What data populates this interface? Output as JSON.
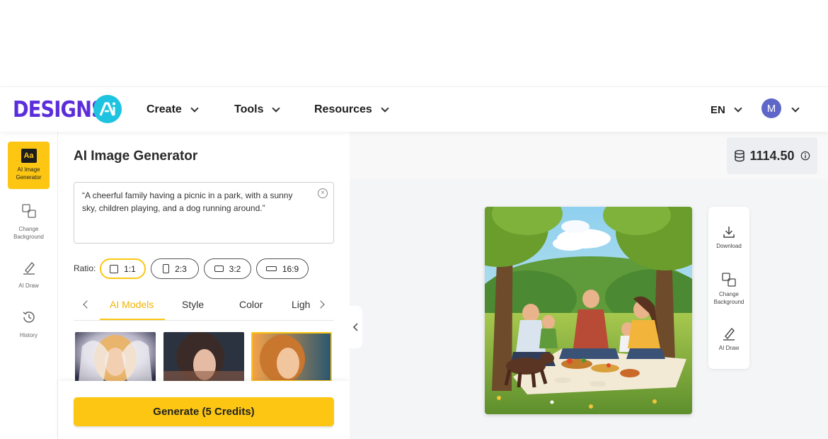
{
  "brand": {
    "logo_text": "DESIGNS.",
    "logo_mark": "AI"
  },
  "nav": {
    "items": [
      {
        "label": "Create"
      },
      {
        "label": "Tools"
      },
      {
        "label": "Resources"
      }
    ],
    "language": "EN",
    "avatar_initial": "M"
  },
  "rail": {
    "items": [
      {
        "label": "AI Image Generator",
        "icon": "aa-icon",
        "active": true
      },
      {
        "label": "Change Background",
        "icon": "change-background-icon"
      },
      {
        "label": "AI Draw",
        "icon": "pen-icon"
      },
      {
        "label": "History",
        "icon": "history-icon"
      }
    ]
  },
  "panel": {
    "title": "AI Image Generator",
    "prompt": "“A cheerful family having a picnic in a park, with a sunny sky, children playing, and a dog running around.”",
    "ratio_label": "Ratio:",
    "ratios": [
      {
        "label": "1:1",
        "active": true
      },
      {
        "label": "2:3"
      },
      {
        "label": "3:2"
      },
      {
        "label": "16:9"
      }
    ],
    "tabs": [
      {
        "label": "AI Models",
        "active": true
      },
      {
        "label": "Style"
      },
      {
        "label": "Color"
      },
      {
        "label": "Ligh"
      }
    ],
    "generate_label": "Generate (5 Credits)"
  },
  "main": {
    "credits": "1114.50",
    "tools": [
      {
        "label": "Download",
        "icon": "download-icon"
      },
      {
        "label": "Change Background",
        "icon": "change-background-icon"
      },
      {
        "label": "AI Draw",
        "icon": "pen-icon"
      }
    ]
  },
  "colors": {
    "accent": "#fcc613",
    "brand_purple": "#5b2ddb",
    "brand_cyan": "#1ec3e0",
    "avatar": "#5e67c9"
  }
}
